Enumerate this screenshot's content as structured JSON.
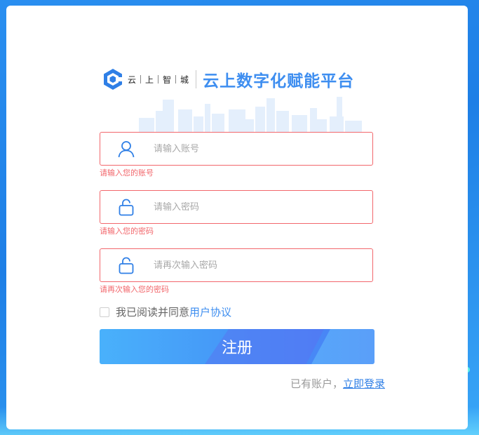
{
  "brand": {
    "chars": [
      "云",
      "上",
      "智",
      "城"
    ],
    "platform_title": "云上数字化赋能平台"
  },
  "form": {
    "account": {
      "placeholder": "请输入账号",
      "error": "请输入您的账号",
      "icon": "user-icon"
    },
    "password": {
      "placeholder": "请输入密码",
      "error": "请输入您的密码",
      "icon": "lock-icon"
    },
    "confirm": {
      "placeholder": "请再次输入密码",
      "error": "请再次输入您的密码",
      "icon": "lock-icon"
    },
    "agree_prefix": "我已阅读并同意",
    "agree_link": "用户协议",
    "submit_label": "注册"
  },
  "footer": {
    "have_account": "已有账户，",
    "login_link": "立即登录"
  },
  "colors": {
    "accent": "#3e8ef0",
    "error": "#f2676c",
    "background": "#1e7fe6"
  }
}
